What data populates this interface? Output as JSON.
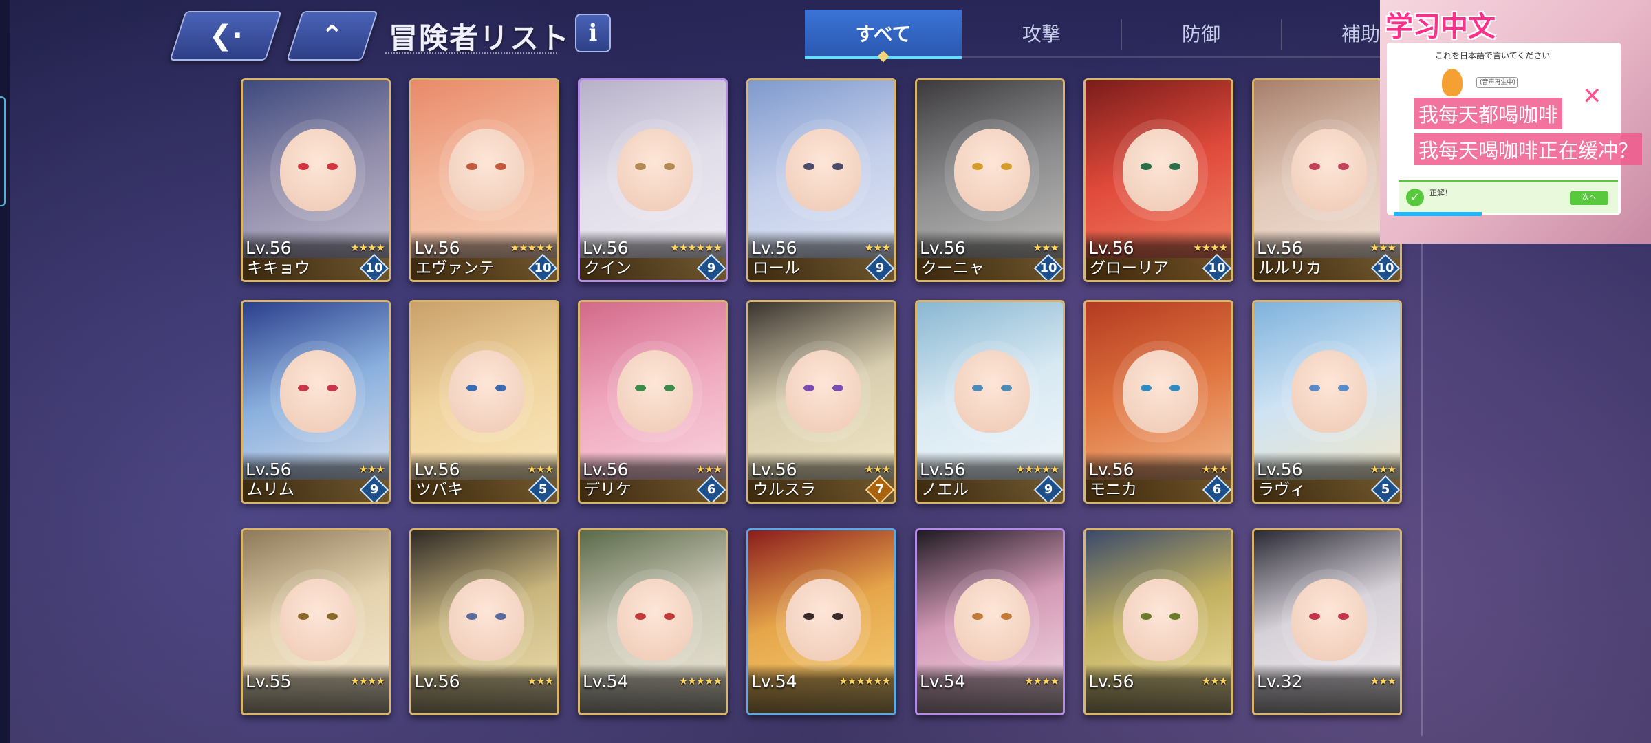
{
  "header": {
    "back_icon": "back-arrow-icon",
    "home_icon": "home-icon",
    "title": "冒険者リスト",
    "info_label": "i"
  },
  "tabs": [
    {
      "label": "すべて",
      "active": true
    },
    {
      "label": "攻撃",
      "active": false
    },
    {
      "label": "防御",
      "active": false
    },
    {
      "label": "補助",
      "active": false
    }
  ],
  "adventurers": [
    {
      "level": "Lv.56",
      "name": "キキョウ",
      "stars": "★★★★",
      "badge": "10",
      "palette": [
        "#3e4a7e",
        "#8e8aa8",
        "#c9c6d6"
      ],
      "eye": "#d2353e",
      "frame": "gold"
    },
    {
      "level": "Lv.56",
      "name": "エヴァンテ",
      "stars": "★★★★★",
      "badge": "10",
      "palette": [
        "#e88a6a",
        "#f3b79a",
        "#f8d7c3"
      ],
      "eye": "#c25a3e",
      "frame": "gold"
    },
    {
      "level": "Lv.56",
      "name": "クイン",
      "stars": "★★★★★★",
      "badge": "9",
      "palette": [
        "#b7b1c9",
        "#e1dde9",
        "#f1eef5"
      ],
      "eye": "#b48a54",
      "frame": "purple"
    },
    {
      "level": "Lv.56",
      "name": "ロール",
      "stars": "★★★",
      "badge": "9",
      "palette": [
        "#7f9acd",
        "#c2cde9",
        "#e6ecf7"
      ],
      "eye": "#4a4a6a",
      "frame": "gold"
    },
    {
      "level": "Lv.56",
      "name": "クーニャ",
      "stars": "★★★",
      "badge": "10",
      "palette": [
        "#3c3a3c",
        "#8a8a8c",
        "#c8c6c2"
      ],
      "eye": "#d69c2a",
      "frame": "gold"
    },
    {
      "level": "Lv.56",
      "name": "グローリア",
      "stars": "★★★★",
      "badge": "10",
      "palette": [
        "#7a1c1c",
        "#e04a3a",
        "#f28a6a"
      ],
      "eye": "#2a6e4a",
      "frame": "gold"
    },
    {
      "level": "Lv.56",
      "name": "ルルリカ",
      "stars": "★★★",
      "badge": "10",
      "palette": [
        "#a77f6c",
        "#e0c7b7",
        "#f4e4da"
      ],
      "eye": "#c2445a",
      "frame": "gold"
    },
    {
      "level": "Lv.56",
      "name": "ムリム",
      "stars": "★★★",
      "badge": "9",
      "palette": [
        "#2b3f8c",
        "#8ab0de",
        "#e4e6ee"
      ],
      "eye": "#c9364a",
      "frame": "gold"
    },
    {
      "level": "Lv.56",
      "name": "ツバキ",
      "stars": "★★★",
      "badge": "5",
      "palette": [
        "#c9a06a",
        "#f0d39c",
        "#fbeac4"
      ],
      "eye": "#3a6ab0",
      "frame": "gold"
    },
    {
      "level": "Lv.56",
      "name": "デリケ",
      "stars": "★★★",
      "badge": "6",
      "palette": [
        "#d26a8a",
        "#f0a9bf",
        "#fadde5"
      ],
      "eye": "#3e8a4a",
      "frame": "gold"
    },
    {
      "level": "Lv.56",
      "name": "ウルスラ",
      "stars": "★★★",
      "badge": "7",
      "palette": [
        "#3a3430",
        "#d9cfb0",
        "#f6ebc8"
      ],
      "eye": "#7a4ab0",
      "frame": "gold",
      "badge_color": "orange"
    },
    {
      "level": "Lv.56",
      "name": "ノエル",
      "stars": "★★★★★",
      "badge": "9",
      "palette": [
        "#8ab7d2",
        "#d8e9f2",
        "#f4f8fb"
      ],
      "eye": "#4e8ab8",
      "frame": "gold"
    },
    {
      "level": "Lv.56",
      "name": "モニカ",
      "stars": "★★★",
      "badge": "6",
      "palette": [
        "#b33a22",
        "#e0743e",
        "#f3c49a"
      ],
      "eye": "#2f8ac2",
      "frame": "gold"
    },
    {
      "level": "Lv.56",
      "name": "ラヴィ",
      "stars": "★★★",
      "badge": "5",
      "palette": [
        "#7fb2dc",
        "#cfe3f3",
        "#f6e7c2"
      ],
      "eye": "#5a8ac8",
      "frame": "gold"
    },
    {
      "level": "Lv.55",
      "name": "",
      "stars": "★★★★",
      "badge": "",
      "palette": [
        "#8c7a5a",
        "#e4d2ae",
        "#f6ead2"
      ],
      "eye": "#8a6a2a",
      "frame": "gold"
    },
    {
      "level": "Lv.56",
      "name": "",
      "stars": "★★★",
      "badge": "",
      "palette": [
        "#2e2a26",
        "#c9b67e",
        "#f0e2b4"
      ],
      "eye": "#5a6a9a",
      "frame": "gold"
    },
    {
      "level": "Lv.54",
      "name": "",
      "stars": "★★★★★",
      "badge": "",
      "palette": [
        "#5a6a4a",
        "#c9c6b4",
        "#ede7d6"
      ],
      "eye": "#c23a3a",
      "frame": "gold"
    },
    {
      "level": "Lv.54",
      "name": "",
      "stars": "★★★★★★",
      "badge": "",
      "palette": [
        "#8a1c1c",
        "#e6a64a",
        "#f6d27a"
      ],
      "eye": "#3a2a2a",
      "frame": "blue"
    },
    {
      "level": "Lv.54",
      "name": "",
      "stars": "★★★★",
      "badge": "",
      "palette": [
        "#1e1a22",
        "#d49ab6",
        "#f4e0e8"
      ],
      "eye": "#c27a3a",
      "frame": "purple"
    },
    {
      "level": "Lv.56",
      "name": "",
      "stars": "★★★",
      "badge": "",
      "palette": [
        "#3a4a6a",
        "#c2b060",
        "#f3e3a8"
      ],
      "eye": "#6a7a2a",
      "frame": "gold"
    },
    {
      "level": "Lv.32",
      "name": "",
      "stars": "★★★",
      "badge": "",
      "palette": [
        "#2a2a34",
        "#d6d0d8",
        "#f3eef0"
      ],
      "eye": "#c2364a",
      "frame": "gold"
    }
  ],
  "overlay": {
    "title": "学习中文",
    "prompt": "これを日本語で言いてください",
    "audio_label": "(音声再生中)",
    "line1": "我每天都喝咖啡",
    "line2": "我每天喝咖啡正在缓冲？",
    "correct_label": "正解！",
    "next_label": "次へ",
    "close_icon": "close-icon"
  }
}
